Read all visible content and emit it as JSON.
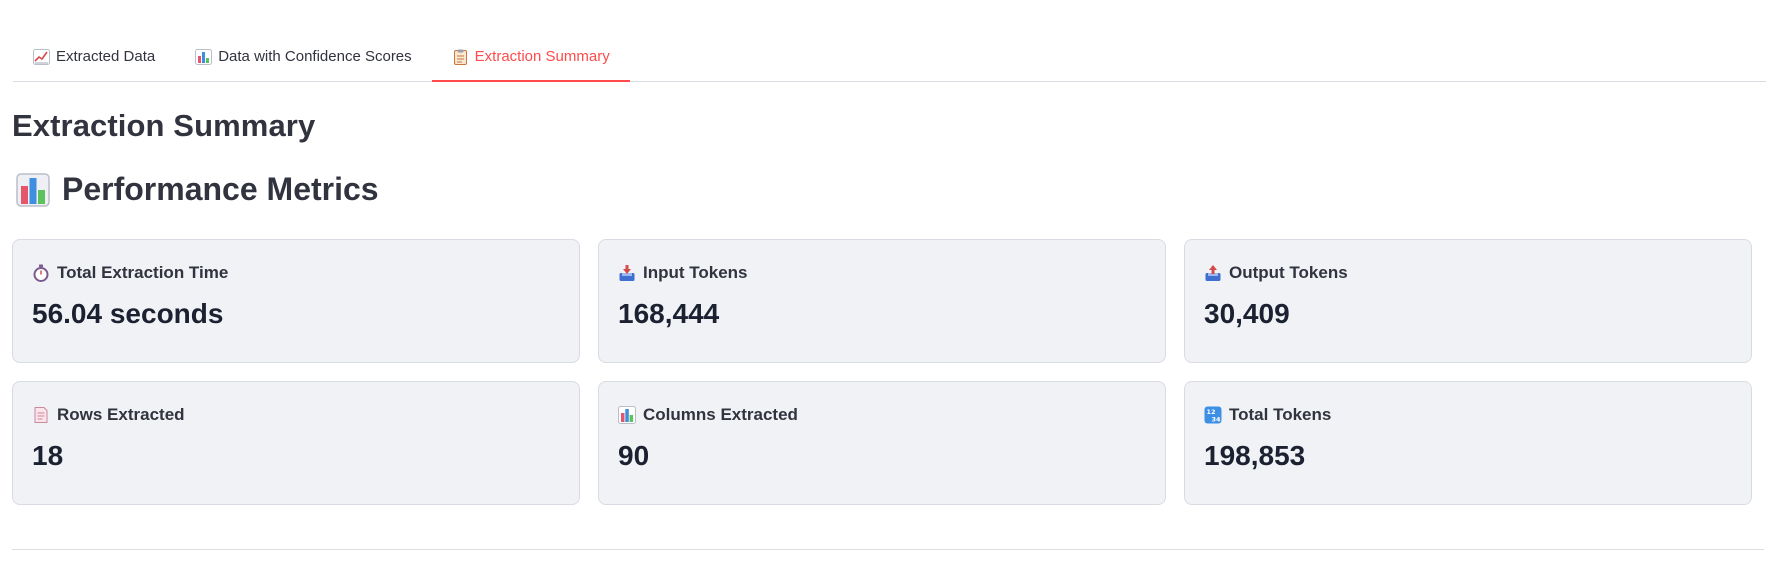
{
  "tabs": [
    {
      "label": "Extracted Data",
      "icon": "line-chart-icon",
      "active": false
    },
    {
      "label": "Data with Confidence Scores",
      "icon": "bar-chart-icon",
      "active": false
    },
    {
      "label": "Extraction Summary",
      "icon": "clipboard-icon",
      "active": true
    }
  ],
  "section_title": "Extraction Summary",
  "subsection": {
    "title": "Performance Metrics",
    "icon": "bar-chart-icon"
  },
  "metrics": [
    {
      "label": "Total Extraction Time",
      "value": "56.04 seconds",
      "icon": "stopwatch-icon"
    },
    {
      "label": "Input Tokens",
      "value": "168,444",
      "icon": "inbox-tray-icon"
    },
    {
      "label": "Output Tokens",
      "value": "30,409",
      "icon": "outbox-tray-icon"
    },
    {
      "label": "Rows Extracted",
      "value": "18",
      "icon": "page-icon"
    },
    {
      "label": "Columns Extracted",
      "value": "90",
      "icon": "bar-chart-icon"
    },
    {
      "label": "Total Tokens",
      "value": "198,853",
      "icon": "numbers-icon"
    }
  ],
  "colors": {
    "accent": "#ff4b4b",
    "card_bg": "#f0f2f6",
    "text": "#31333f"
  }
}
